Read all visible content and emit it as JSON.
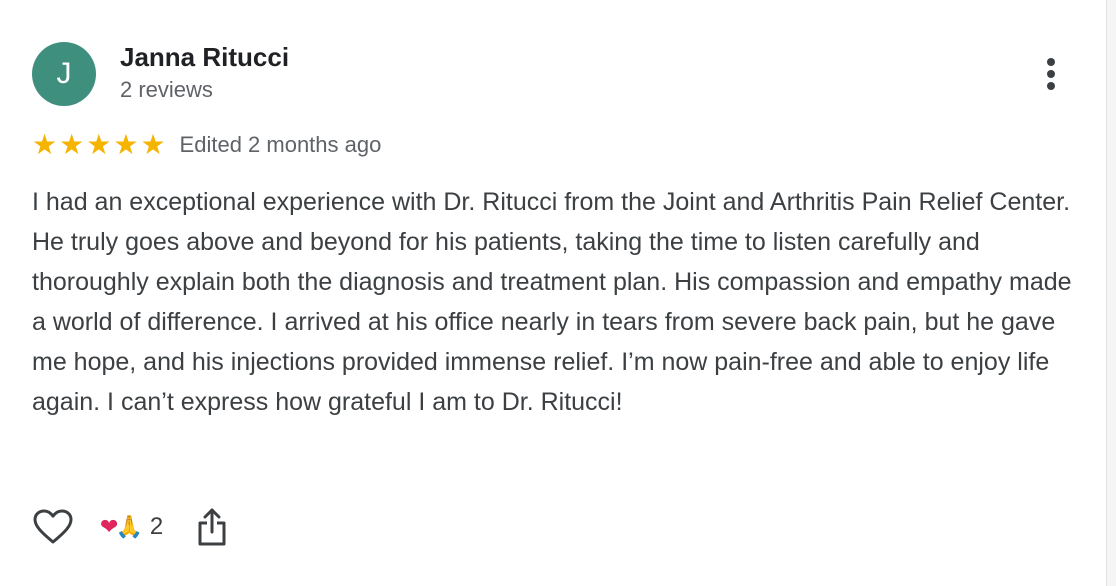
{
  "reviewer": {
    "initial": "J",
    "avatar_color": "#3f8f7f",
    "name": "Janna Ritucci",
    "review_count": "2 reviews"
  },
  "rating": {
    "stars": 5,
    "max_stars": 5,
    "star_color": "#f4b400",
    "edited_text": "Edited 2 months ago"
  },
  "review": {
    "text": "I had an exceptional experience with Dr. Ritucci from the Joint and Arthritis Pain Relief Center. He truly goes above and beyond for his patients, taking the time to listen carefully and thoroughly explain both the diagnosis and treatment plan. His compassion and empathy made a world of difference. I arrived at his office nearly in tears from severe back pain, but he gave me hope, and his injections provided immense relief. I’m now pain-free and able to enjoy life again. I can’t express how grateful I am to Dr. Ritucci!"
  },
  "actions": {
    "like_icon": "heart-outline-icon",
    "reactions": {
      "heart": "❤",
      "pray": "🙏",
      "count": "2"
    },
    "share_icon": "share-icon"
  },
  "menu": {
    "icon": "more-vert-icon"
  }
}
